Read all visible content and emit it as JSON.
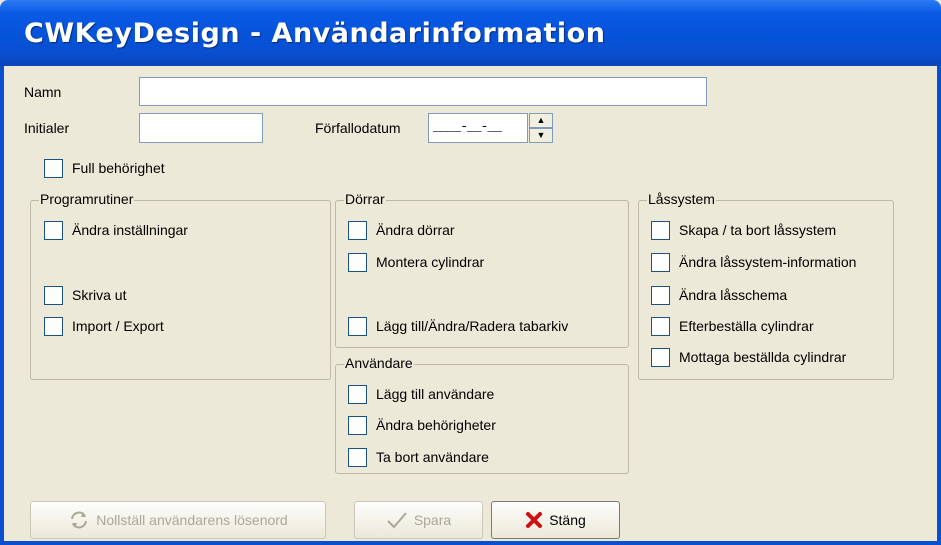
{
  "window": {
    "title": "CWKeyDesign - Användarinformation"
  },
  "form": {
    "name_label": "Namn",
    "name_value": "",
    "initials_label": "Initialer",
    "initials_value": "",
    "expiry_label": "Förfallodatum",
    "expiry_value": "____-__-__",
    "full_access_label": "Full behörighet"
  },
  "groups": {
    "programrutiner": {
      "title": "Programrutiner",
      "items": [
        "Ändra inställningar",
        "Skriva ut",
        "Import / Export"
      ]
    },
    "dorrar": {
      "title": "Dörrar",
      "items": [
        "Ändra dörrar",
        "Montera cylindrar",
        "Lägg till/Ändra/Radera tabarkiv"
      ]
    },
    "anvandare": {
      "title": "Användare",
      "items": [
        "Lägg till användare",
        "Ändra behörigheter",
        "Ta bort användare"
      ]
    },
    "lassystem": {
      "title": "Låssystem",
      "items": [
        "Skapa / ta bort låssystem",
        "Ändra låssystem-information",
        "Ändra låsschema",
        "Efterbeställa cylindrar",
        "Mottaga beställda cylindrar"
      ]
    }
  },
  "buttons": {
    "reset_password": "Nollställ användarens lösenord",
    "save": "Spara",
    "close": "Stäng"
  },
  "icons": {
    "reset": "refresh-arrows-icon",
    "save": "checkmark-icon",
    "close": "red-x-icon"
  }
}
